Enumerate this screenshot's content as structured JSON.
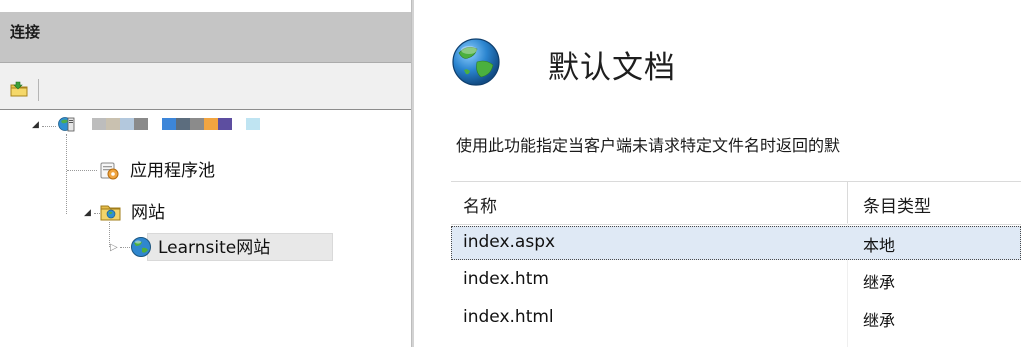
{
  "connections": {
    "title": "连接",
    "tree": {
      "server_label_redacted": true,
      "redaction_colors": [
        "#bdbdbd",
        "#c9c1b0",
        "#b3c8dd",
        "#8a8a8a",
        "#ffffff",
        "#3d86d9",
        "#5c6d7e",
        "#8b8b8b",
        "#f2a541",
        "#5d4ea0",
        "#ffffff",
        "#bfe4f2"
      ],
      "app_pools_label": "应用程序池",
      "sites_label": "网站",
      "site_label": "Learnsite网站"
    }
  },
  "main": {
    "title": "默认文档",
    "description": "使用此功能指定当客户端未请求特定文件名时返回的默",
    "columns": [
      "名称",
      "条目类型"
    ],
    "rows": [
      {
        "name": "index.aspx",
        "type": "本地",
        "selected": true
      },
      {
        "name": "index.htm",
        "type": "继承",
        "selected": false
      },
      {
        "name": "index.html",
        "type": "继承",
        "selected": false
      }
    ]
  },
  "icons": {
    "toolbar": "folder-connect-icon",
    "server": "server-icon",
    "app_pools": "app-pool-icon",
    "sites": "sites-folder-icon",
    "site": "globe-icon",
    "page": "globe-icon"
  }
}
